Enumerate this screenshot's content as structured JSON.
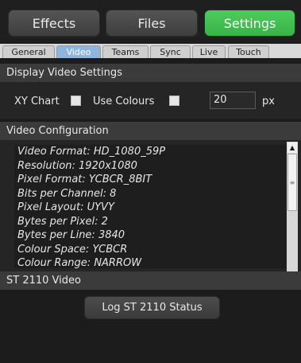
{
  "topbar": {
    "buttons": [
      {
        "label": "Effects"
      },
      {
        "label": "Files"
      },
      {
        "label": "Settings"
      }
    ],
    "active_color": "#43c053"
  },
  "tabs": {
    "items": [
      {
        "label": "General"
      },
      {
        "label": "Video"
      },
      {
        "label": "Teams"
      },
      {
        "label": "Sync"
      },
      {
        "label": "Live"
      },
      {
        "label": "Touch"
      }
    ],
    "selected": "Video"
  },
  "display": {
    "header": "Display Video Settings",
    "xy_chart_label": "XY Chart",
    "use_colours_label": "Use Colours",
    "size_value": "20",
    "size_unit": "px"
  },
  "config": {
    "header": "Video Configuration",
    "lines": [
      "Video Format: HD_1080_59P",
      "Resolution: 1920x1080",
      "Pixel Format: YCBCR_8BIT",
      "Bits per Channel: 8",
      "Pixel Layout: UYVY",
      "Bytes per Pixel: 2",
      "Bytes per Line: 3840",
      "Colour Space: YCBCR",
      "Colour Range: NARROW"
    ]
  },
  "st2110": {
    "header": "ST 2110 Video",
    "log_button": "Log ST 2110 Status"
  }
}
